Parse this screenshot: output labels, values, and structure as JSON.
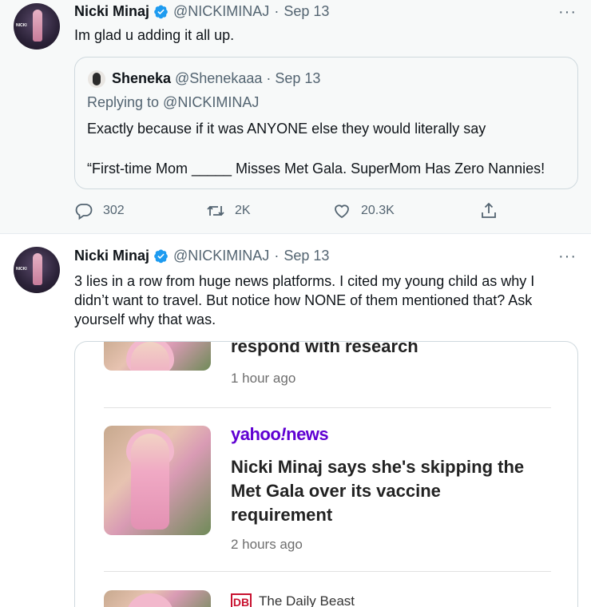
{
  "tweet1": {
    "name": "Nicki Minaj",
    "handle": "@NICKIMINAJ",
    "dot": "·",
    "date": "Sep 13",
    "more": "···",
    "text": "Im glad u adding it all up.",
    "quote": {
      "name": "Sheneka",
      "handle": "@Shenekaaa",
      "dot": "·",
      "date": "Sep 13",
      "replying": "Replying to @NICKIMINAJ",
      "line1": "Exactly because if it was ANYONE else they would literally say",
      "line2": "“First-time Mom _____ Misses Met Gala. SuperMom Has Zero Nannies!"
    },
    "actions": {
      "reply_count": "302",
      "retweet_count": "2K",
      "like_count": "20.3K"
    }
  },
  "tweet2": {
    "name": "Nicki Minaj",
    "handle": "@NICKIMINAJ",
    "dot": "·",
    "date": "Sep 13",
    "more": "···",
    "text_line1": "3 lies in a row from huge news platforms. I cited my young child as why I",
    "text_line2": "didn’t want to travel. But notice how NONE of them mentioned that? Ask",
    "text_line3": "yourself why that was.",
    "media": {
      "top_headline": "respond with research",
      "top_time": "1 hour ago",
      "yahoo_brand_a": "yahoo",
      "yahoo_brand_b": "!",
      "yahoo_brand_c": "news",
      "mid_headline_1": "Nicki Minaj says she's skipping the",
      "mid_headline_2": "Met Gala over its vaccine",
      "mid_headline_3": "requirement",
      "mid_time": "2 hours ago",
      "db_logo": "DB",
      "db_name": "The Daily Beast"
    }
  },
  "colors": {
    "verified": "#1d9bf0",
    "secondary_text": "#536471",
    "yahoo_purple": "#6001d2",
    "daily_beast_red": "#c8102e"
  },
  "icons": [
    "verified-badge-icon",
    "reply-icon",
    "retweet-icon",
    "like-icon",
    "share-icon",
    "more-icon"
  ]
}
